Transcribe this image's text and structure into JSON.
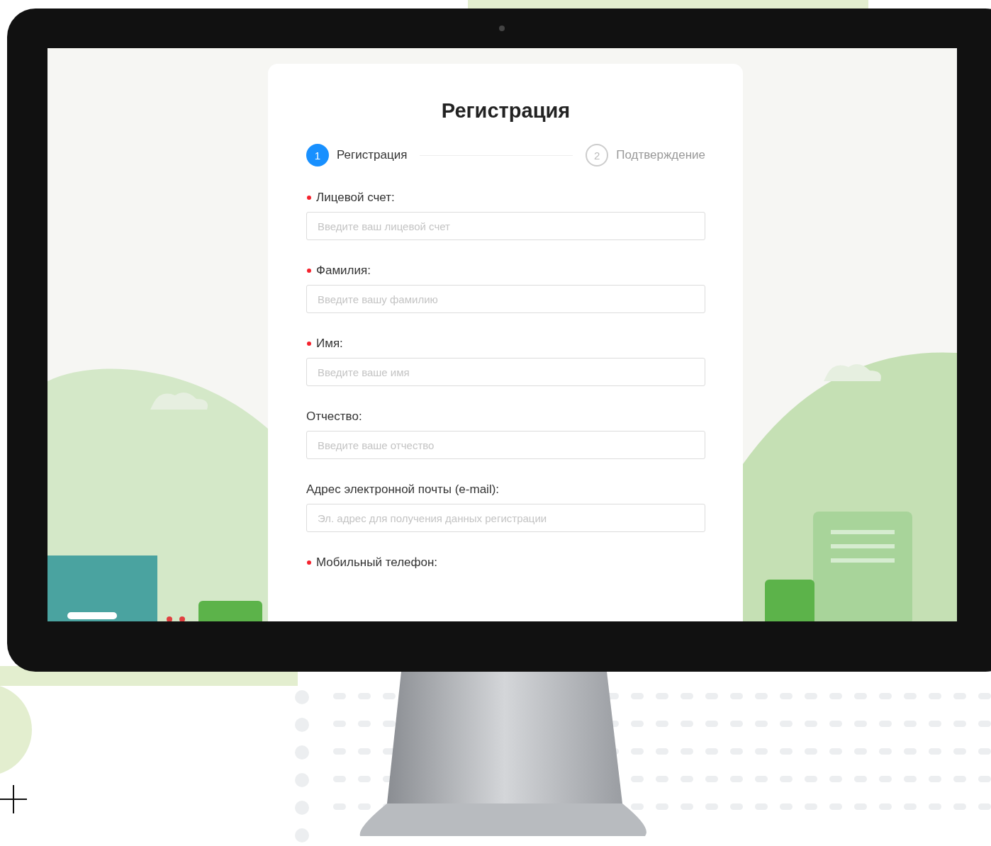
{
  "title": "Регистрация",
  "steps": [
    {
      "number": "1",
      "label": "Регистрация",
      "selected": true
    },
    {
      "number": "2",
      "label": "Подтверждение",
      "selected": false
    }
  ],
  "fields": [
    {
      "label": "Лицевой счет:",
      "required": true,
      "placeholder": "Введите ваш лицевой счет"
    },
    {
      "label": "Фамилия:",
      "required": true,
      "placeholder": "Введите вашу фамилию"
    },
    {
      "label": "Имя:",
      "required": true,
      "placeholder": "Введите ваше имя"
    },
    {
      "label": "Отчество:",
      "required": false,
      "placeholder": "Введите ваше отчество"
    },
    {
      "label": "Адрес электронной почты (e-mail):",
      "required": false,
      "placeholder": "Эл. адрес для получения данных регистрации"
    },
    {
      "label": "Мобильный телефон:",
      "required": true
    }
  ]
}
